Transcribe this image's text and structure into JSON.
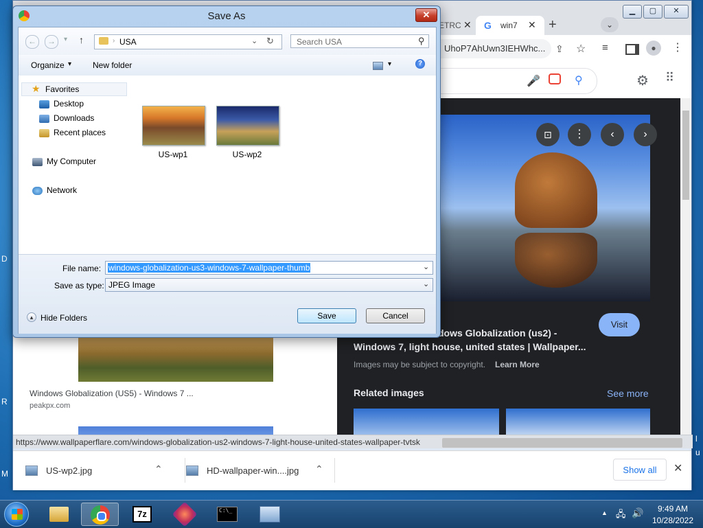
{
  "desktop": {
    "frag_left_1": "D",
    "frag_left_2": "R",
    "frag_left_3": "M",
    "frag_right_1": "l",
    "frag_right_2": "u"
  },
  "browser": {
    "tab_partial": "ETRC",
    "tab_active": "win7",
    "url_partial": "UhoP7AhUwn3IEHWhc...",
    "result_title_line1": "dows Globalization (us2) -",
    "result_title_line2": "Windows 7, light house, united states | Wallpaper...",
    "copyright_text": "Images may be subject to copyright.",
    "learn_more": "Learn More",
    "visit_button": "Visit",
    "related_images": "Related images",
    "see_more": "See more",
    "left_card_title": "Windows Globalization (US5) - Windows 7 ...",
    "left_card_source": "peakpx.com",
    "status_url": "https://www.wallpaperflare.com/windows-globalization-us2-windows-7-light-house-united-states-wallpaper-tvtsk",
    "downloads": [
      {
        "name": "US-wp2.jpg"
      },
      {
        "name": "HD-wallpaper-win....jpg"
      }
    ],
    "show_all": "Show all"
  },
  "dialog": {
    "title": "Save As",
    "address": "USA",
    "search_placeholder": "Search USA",
    "organize": "Organize",
    "new_folder": "New folder",
    "nav": {
      "favorites": "Favorites",
      "desktop": "Desktop",
      "downloads": "Downloads",
      "recent": "Recent places",
      "computer": "My Computer",
      "network": "Network"
    },
    "files": [
      {
        "name": "US-wp1"
      },
      {
        "name": "US-wp2"
      }
    ],
    "file_name_label": "File name:",
    "file_name_value": "windows-globalization-us3-windows-7-wallpaper-thumb",
    "save_type_label": "Save as type:",
    "save_type_value": "JPEG Image",
    "hide_folders": "Hide Folders",
    "save_button": "Save",
    "cancel_button": "Cancel"
  },
  "taskbar": {
    "time": "9:49 AM",
    "date": "10/28/2022",
    "app_7z": "7z"
  },
  "colors": {
    "accent": "#3a7bd5",
    "visit": "#8ab4f8",
    "dark_panel": "#202124",
    "selection": "#3399ff"
  }
}
